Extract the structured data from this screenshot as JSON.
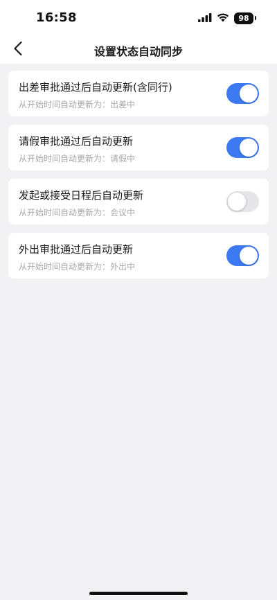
{
  "status_bar": {
    "time": "16:58",
    "battery": "98",
    "icons": [
      "signal-icon",
      "wifi-icon",
      "battery-icon"
    ]
  },
  "nav": {
    "title": "设置状态自动同步",
    "back_icon": "chevron-left-icon"
  },
  "colors": {
    "toggle_on": "#3d7af2",
    "toggle_off": "#e6e6ea",
    "background": "#f2f2f4"
  },
  "settings": [
    {
      "title": "出差审批通过后自动更新(含同行)",
      "subtitle": "从开始时间自动更新为：出差中",
      "enabled": true
    },
    {
      "title": "请假审批通过后自动更新",
      "subtitle": "从开始时间自动更新为：请假中",
      "enabled": true
    },
    {
      "title": "发起或接受日程后自动更新",
      "subtitle": "从开始时间自动更新为：会议中",
      "enabled": false
    },
    {
      "title": "外出审批通过后自动更新",
      "subtitle": "从开始时间自动更新为：外出中",
      "enabled": true
    }
  ]
}
